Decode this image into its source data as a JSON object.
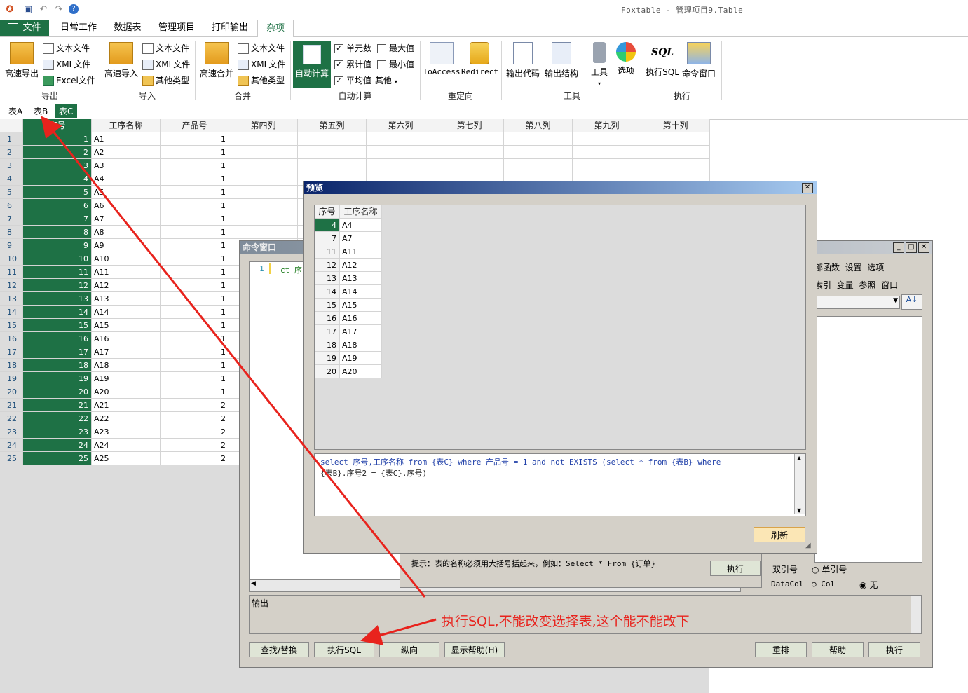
{
  "app": {
    "title": "Foxtable - 管理项目9.Table"
  },
  "menu": {
    "tabs": [
      "文件",
      "日常工作",
      "数据表",
      "管理项目",
      "打印输出",
      "杂项"
    ]
  },
  "ribbon": {
    "export": {
      "big": "高速导出",
      "items": [
        "文本文件",
        "XML文件",
        "Excel文件"
      ],
      "group": "导出"
    },
    "import": {
      "big": "高速导入",
      "items": [
        "文本文件",
        "XML文件",
        "其他类型"
      ],
      "group": "导入"
    },
    "merge": {
      "big": "高速合并",
      "items": [
        "文本文件",
        "XML文件",
        "其他类型"
      ],
      "group": "合并"
    },
    "autocalc": {
      "big": "自动计算",
      "checks": [
        "单元数",
        "最大值",
        "累计值",
        "最小值",
        "平均值",
        "其他"
      ],
      "group": "自动计算"
    },
    "redirect": {
      "items": [
        "ToAccess",
        "Redirect"
      ],
      "group": "重定向"
    },
    "tools": {
      "items": [
        "输出代码",
        "输出结构",
        "工具",
        "选项"
      ],
      "group": "工具"
    },
    "exec": {
      "items": [
        "执行SQL",
        "命令窗口"
      ],
      "group": "执行"
    }
  },
  "sheet_tabs": [
    "表A",
    "表B",
    "表C"
  ],
  "grid": {
    "columns": [
      "序号",
      "工序名称",
      "产品号",
      "第四列",
      "第五列",
      "第六列",
      "第七列",
      "第八列",
      "第九列",
      "第十列"
    ],
    "rows": [
      [
        "1",
        "1",
        "A1",
        "1"
      ],
      [
        "2",
        "2",
        "A2",
        "1"
      ],
      [
        "3",
        "3",
        "A3",
        "1"
      ],
      [
        "4",
        "4",
        "A4",
        "1"
      ],
      [
        "5",
        "5",
        "A5",
        "1"
      ],
      [
        "6",
        "6",
        "A6",
        "1"
      ],
      [
        "7",
        "7",
        "A7",
        "1"
      ],
      [
        "8",
        "8",
        "A8",
        "1"
      ],
      [
        "9",
        "9",
        "A9",
        "1"
      ],
      [
        "10",
        "10",
        "A10",
        "1"
      ],
      [
        "11",
        "11",
        "A11",
        "1"
      ],
      [
        "12",
        "12",
        "A12",
        "1"
      ],
      [
        "13",
        "13",
        "A13",
        "1"
      ],
      [
        "14",
        "14",
        "A14",
        "1"
      ],
      [
        "15",
        "15",
        "A15",
        "1"
      ],
      [
        "16",
        "16",
        "A16",
        "1"
      ],
      [
        "17",
        "17",
        "A17",
        "1"
      ],
      [
        "18",
        "18",
        "A18",
        "1"
      ],
      [
        "19",
        "19",
        "A19",
        "1"
      ],
      [
        "20",
        "20",
        "A20",
        "1"
      ],
      [
        "21",
        "21",
        "A21",
        "2"
      ],
      [
        "22",
        "22",
        "A22",
        "2"
      ],
      [
        "23",
        "23",
        "A23",
        "2"
      ],
      [
        "24",
        "24",
        "A24",
        "2"
      ],
      [
        "25",
        "25",
        "A25",
        "2"
      ]
    ]
  },
  "cmd_window": {
    "title": "命令窗口",
    "editor_line_no": "1",
    "editor_text": "ct 序",
    "menu1": [
      "部函数",
      "设置",
      "选项"
    ],
    "menu2": [
      "索引",
      "变量",
      "参照",
      "窗口"
    ],
    "tip": "提示：表的名称必须用大括号括起来，例如：Select * From {订单}",
    "exec_inner": "执行",
    "quote_label": "双引号",
    "single_quote": "单引号",
    "datacol": "DataCol",
    "col": "Col",
    "none": "无",
    "output_label": "输出",
    "buttons": [
      "查找/替换",
      "执行SQL",
      "纵向",
      "显示帮助(H)",
      "重排",
      "帮助",
      "执行"
    ]
  },
  "preview": {
    "title": "预览",
    "columns": [
      "序号",
      "工序名称"
    ],
    "rows": [
      [
        "4",
        "A4"
      ],
      [
        "7",
        "A7"
      ],
      [
        "11",
        "A11"
      ],
      [
        "12",
        "A12"
      ],
      [
        "13",
        "A13"
      ],
      [
        "14",
        "A14"
      ],
      [
        "15",
        "A15"
      ],
      [
        "16",
        "A16"
      ],
      [
        "17",
        "A17"
      ],
      [
        "18",
        "A18"
      ],
      [
        "19",
        "A19"
      ],
      [
        "20",
        "A20"
      ]
    ],
    "sql_line1": "select 序号,工序名称 from {表C} where 产品号 = 1 and not EXISTS (select * from {表B} where",
    "sql_line2": "{表B}.序号2 = {表C}.序号)",
    "refresh": "刷新"
  },
  "annotation": {
    "text": "执行SQL,不能改变选择表,这个能不能改下",
    "color": "#e8231d"
  }
}
